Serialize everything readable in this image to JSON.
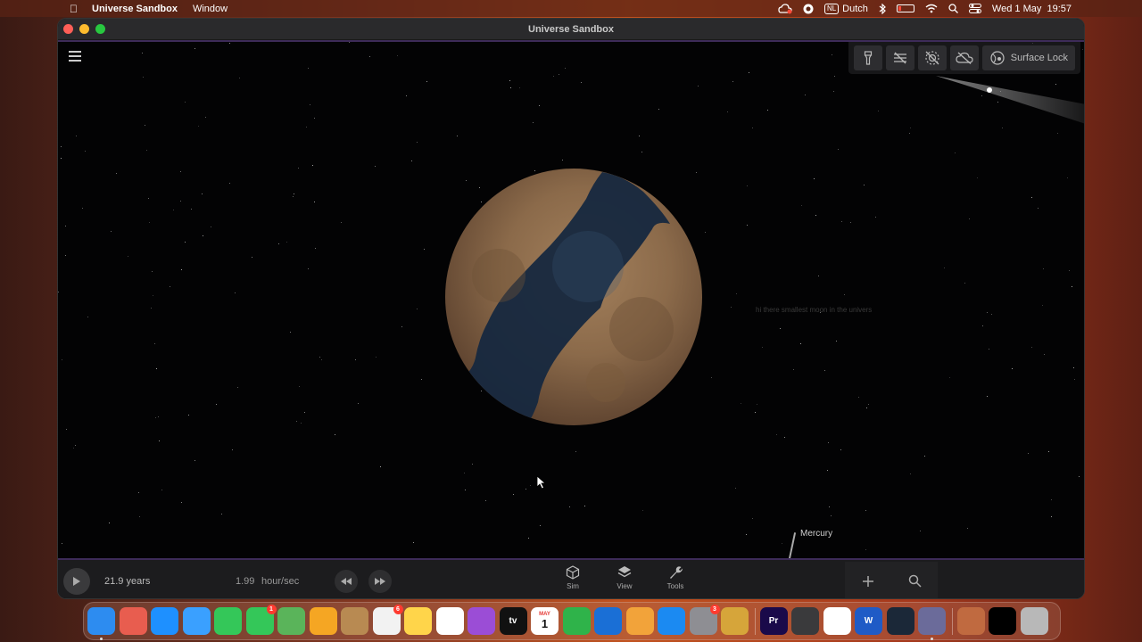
{
  "menubar": {
    "apple_icon": "apple-icon",
    "app_name": "Universe Sandbox",
    "menus": [
      "Window"
    ],
    "input_source": "NL",
    "input_language": "Dutch",
    "date_time": "Wed 1 May  19:57"
  },
  "window": {
    "title": "Universe Sandbox"
  },
  "top_toolbar": {
    "surface_lock_label": "Surface Lock"
  },
  "scene": {
    "moon_label": "hi there smallest moon in the univers",
    "mercury_label": "Mercury"
  },
  "bottom_bar": {
    "elapsed": "21.9 years",
    "rate_value": "1.99",
    "rate_unit": "hour/sec",
    "nav": [
      {
        "label": "Sim",
        "icon": "cube-icon"
      },
      {
        "label": "View",
        "icon": "layers-icon"
      },
      {
        "label": "Tools",
        "icon": "wrench-icon"
      }
    ]
  },
  "dock": {
    "items": [
      {
        "name": "finder",
        "color": "#2d8cf0",
        "text": "",
        "dot": true
      },
      {
        "name": "launchpad",
        "color": "#e85d4f",
        "text": ""
      },
      {
        "name": "safari",
        "color": "#1e90ff",
        "text": ""
      },
      {
        "name": "mail",
        "color": "#3aa0ff",
        "text": ""
      },
      {
        "name": "facetime",
        "color": "#34c759",
        "text": ""
      },
      {
        "name": "messages",
        "color": "#34c759",
        "text": "",
        "badge": "1"
      },
      {
        "name": "maps",
        "color": "#5ab45a",
        "text": ""
      },
      {
        "name": "photos",
        "color": "#f5a623",
        "text": ""
      },
      {
        "name": "contacts",
        "color": "#b88a52",
        "text": ""
      },
      {
        "name": "reminders",
        "color": "#f2f2f2",
        "text": "",
        "badge": "6"
      },
      {
        "name": "notes",
        "color": "#ffd54a",
        "text": ""
      },
      {
        "name": "freeform",
        "color": "#ffffff",
        "text": ""
      },
      {
        "name": "podcasts",
        "color": "#9b4dd6",
        "text": ""
      },
      {
        "name": "tv",
        "color": "#111111",
        "text": "tv"
      },
      {
        "name": "calendar",
        "color": "#ffffff",
        "text": "1",
        "month": "MAY"
      },
      {
        "name": "numbers",
        "color": "#2fb34a",
        "text": ""
      },
      {
        "name": "keynote",
        "color": "#1a6fd6",
        "text": ""
      },
      {
        "name": "pages",
        "color": "#f2a33a",
        "text": ""
      },
      {
        "name": "app-store",
        "color": "#1b8af2",
        "text": ""
      },
      {
        "name": "system-settings",
        "color": "#8e8e93",
        "text": "",
        "badge": "3"
      },
      {
        "name": "archive-utility",
        "color": "#d6a53a",
        "text": ""
      },
      {
        "name": "premiere-pro",
        "color": "#1a0a4a",
        "text": "Pr",
        "sep_before": true
      },
      {
        "name": "quicktime",
        "color": "#3a3a3c",
        "text": ""
      },
      {
        "name": "chrome",
        "color": "#ffffff",
        "text": ""
      },
      {
        "name": "word",
        "color": "#1f5bc6",
        "text": "W"
      },
      {
        "name": "steam",
        "color": "#1b2838",
        "text": ""
      },
      {
        "name": "universe-sandbox",
        "color": "#6b6b9a",
        "text": "",
        "dot": true
      },
      {
        "name": "preview",
        "color": "#c06a40",
        "text": "",
        "sep_before": true
      },
      {
        "name": "minimized-window",
        "color": "#000000",
        "text": ""
      },
      {
        "name": "trash",
        "color": "#b8b8b8",
        "text": ""
      }
    ]
  }
}
